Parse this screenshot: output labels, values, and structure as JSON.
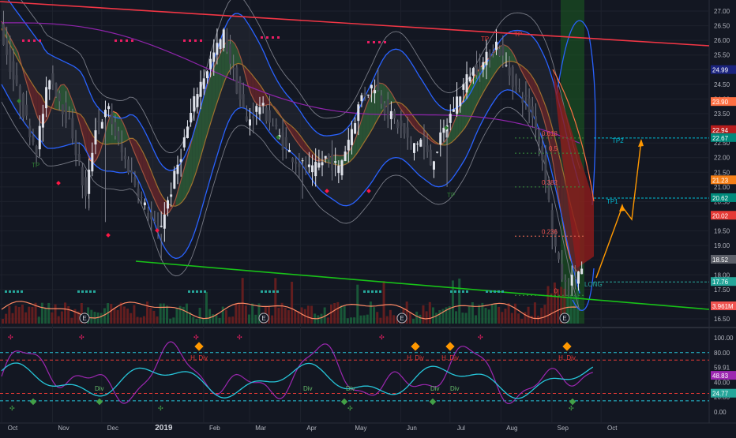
{
  "chart_data": [
    {
      "type": "line",
      "panel": "price",
      "title": "",
      "xlabel": "",
      "ylabel": "",
      "y_axis_ticks": [
        27.0,
        26.5,
        26.0,
        25.5,
        25.0,
        24.5,
        24.0,
        23.5,
        23.0,
        22.5,
        22.0,
        21.5,
        21.0,
        20.5,
        20.0,
        19.5,
        19.0,
        18.5,
        18.0,
        17.5,
        17.0,
        16.5
      ],
      "ylim": [
        16.3,
        27.2
      ],
      "x_axis_ticks": [
        "Oct",
        "Nov",
        "Dec",
        "2019",
        "Feb",
        "Mar",
        "Apr",
        "May",
        "Jun",
        "Jul",
        "Aug",
        "Sep",
        "Oct"
      ],
      "x_tick_index": [
        0,
        31,
        61,
        92,
        123,
        151,
        182,
        212,
        243,
        273,
        304,
        335,
        365
      ],
      "price_labels": [
        {
          "value": "24.99",
          "y": 24.99,
          "color": "#1a237e"
        },
        {
          "value": "23.90",
          "y": 23.9,
          "color": "#ff7043"
        },
        {
          "value": "22.94",
          "y": 22.94,
          "color": "#b71c1c"
        },
        {
          "value": "22.67",
          "y": 22.67,
          "color": "#00897b"
        },
        {
          "value": "21.23",
          "y": 21.23,
          "color": "#f57f17"
        },
        {
          "value": "20.62",
          "y": 20.62,
          "color": "#00897b"
        },
        {
          "value": "20.02",
          "y": 20.02,
          "color": "#e53935"
        },
        {
          "value": "18.52",
          "y": 18.52,
          "color": "#5d6069"
        },
        {
          "value": "17.76",
          "y": 17.76,
          "color": "#26a69a"
        },
        {
          "value": "3.961M",
          "y": 16.93,
          "color": "#ef5350"
        }
      ],
      "fib_levels": [
        {
          "label": "0.618",
          "y": 22.67
        },
        {
          "label": "0.5",
          "y": 22.15
        },
        {
          "label": "0.382",
          "y": 21.0
        },
        {
          "label": "0.236",
          "y": 19.32
        },
        {
          "label": "0",
          "y": 17.3
        }
      ],
      "annotations": [
        "TP",
        "TP",
        "TP",
        "TP",
        "E",
        "E",
        "E",
        "E",
        "TP2",
        "TP1",
        "LONG"
      ],
      "trendlines": [
        {
          "name": "resistance",
          "points": [
            [
              0,
              27.1
            ],
            [
              365,
              25.8
            ]
          ],
          "color": "#f23645"
        },
        {
          "name": "support",
          "points": [
            [
              70,
              18.4
            ],
            [
              365,
              17.1
            ]
          ],
          "color": "#18c218"
        }
      ],
      "targets": {
        "tp1": 20.62,
        "tp2": 22.67,
        "entry": 17.76
      }
    },
    {
      "type": "line",
      "panel": "oscillator",
      "title": "",
      "y_axis_ticks": [
        100.0,
        80.0,
        59.91,
        40.0,
        20.0,
        0.0
      ],
      "ylim": [
        -5,
        108
      ],
      "value_labels": [
        {
          "value": "48.83",
          "y": 48.83,
          "color": "#9c27b0"
        },
        {
          "value": "24.77",
          "y": 24.77,
          "color": "#26a69a"
        }
      ],
      "levels": [
        {
          "y": 80,
          "color": "#26c6da"
        },
        {
          "y": 70,
          "color": "#e53935"
        },
        {
          "y": 25,
          "color": "#e53935"
        },
        {
          "y": 15,
          "color": "#26c6da"
        }
      ],
      "annotations": [
        "H. Div",
        "H. Div",
        "H. Div",
        "H. Div",
        "Div",
        "Div",
        "Div",
        "Div",
        "Div"
      ]
    }
  ]
}
